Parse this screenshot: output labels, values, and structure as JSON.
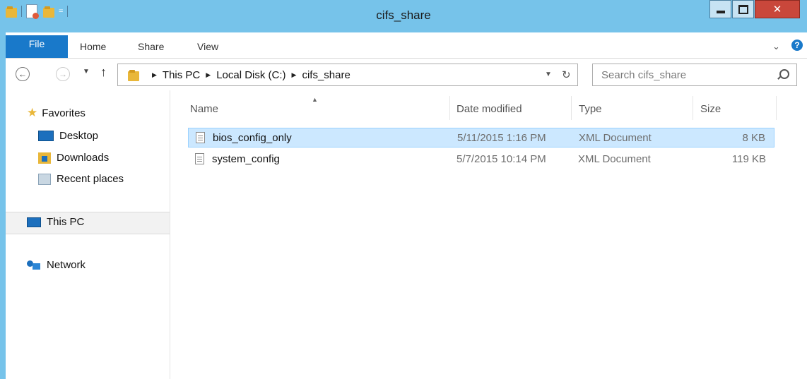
{
  "window": {
    "title": "cifs_share"
  },
  "ribbon": {
    "tabs": [
      {
        "label": "File"
      },
      {
        "label": "Home"
      },
      {
        "label": "Share"
      },
      {
        "label": "View"
      }
    ],
    "help_label": "?"
  },
  "address": {
    "crumbs": [
      "This PC",
      "Local Disk (C:)",
      "cifs_share"
    ]
  },
  "search": {
    "placeholder": "Search cifs_share"
  },
  "nav_pane": {
    "favorites": "Favorites",
    "desktop": "Desktop",
    "downloads": "Downloads",
    "recent_places": "Recent places",
    "this_pc": "This PC",
    "network": "Network"
  },
  "columns": {
    "name": "Name",
    "date_modified": "Date modified",
    "type": "Type",
    "size": "Size"
  },
  "files": [
    {
      "name": "bios_config_only",
      "date": "5/11/2015 1:16 PM",
      "type": "XML Document",
      "size": "8 KB",
      "selected": true
    },
    {
      "name": "system_config",
      "date": "5/7/2015 10:14 PM",
      "type": "XML Document",
      "size": "119 KB",
      "selected": false
    }
  ],
  "colors": {
    "titlebar": "#76c3ea",
    "file_tab": "#1979ca",
    "close_button": "#c9473b",
    "selection": "#cce8ff"
  }
}
